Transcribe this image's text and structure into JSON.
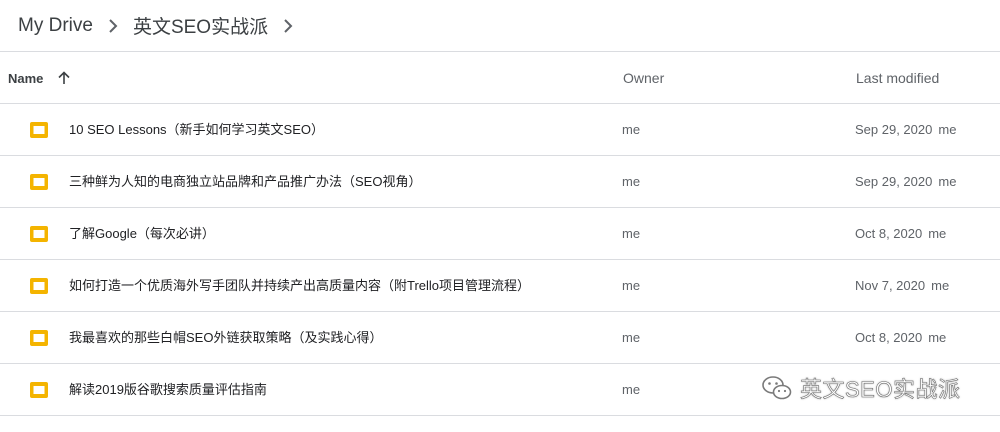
{
  "breadcrumb": {
    "items": [
      "My Drive",
      "英文SEO实战派"
    ]
  },
  "table": {
    "columns": {
      "name": "Name",
      "owner": "Owner",
      "modified": "Last modified"
    },
    "rows": [
      {
        "name": "10 SEO Lessons（新手如何学习英文SEO）",
        "owner": "me",
        "date": "Sep 29, 2020",
        "by": "me"
      },
      {
        "name": "三种鲜为人知的电商独立站品牌和产品推广办法（SEO视角）",
        "owner": "me",
        "date": "Sep 29, 2020",
        "by": "me"
      },
      {
        "name": "了解Google（每次必讲）",
        "owner": "me",
        "date": "Oct 8, 2020",
        "by": "me"
      },
      {
        "name": "如何打造一个优质海外写手团队并持续产出高质量内容（附Trello项目管理流程）",
        "owner": "me",
        "date": "Nov 7, 2020",
        "by": "me"
      },
      {
        "name": "我最喜欢的那些白帽SEO外链获取策略（及实践心得）",
        "owner": "me",
        "date": "Oct 8, 2020",
        "by": "me"
      },
      {
        "name": "解读2019版谷歌搜索质量评估指南",
        "owner": "me",
        "date": "",
        "by": ""
      }
    ]
  },
  "watermark": {
    "text": "英文SEO实战派",
    "icon": "wechat-icon"
  },
  "colors": {
    "slides_icon": "#F4B400",
    "divider": "#dadce0",
    "secondary_text": "#5f6368"
  }
}
